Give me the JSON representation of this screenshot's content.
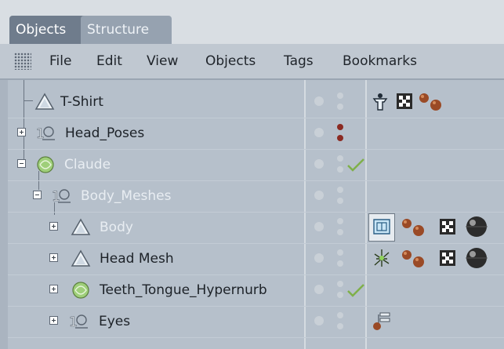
{
  "tabs": [
    {
      "label": "Objects",
      "active": true
    },
    {
      "label": "Structure",
      "active": false
    }
  ],
  "menu": [
    "File",
    "Edit",
    "View",
    "Objects",
    "Tags",
    "Bookmarks"
  ],
  "objects": [
    {
      "name": "T-Shirt",
      "icon": "polygon-object-icon",
      "expander": "none",
      "dim": false,
      "flags": "normal",
      "tags": [
        "character-tag-icon",
        "texture-tag-icon",
        "material-tag-icon"
      ]
    },
    {
      "name": "Head_Poses",
      "icon": "null-object-icon",
      "expander": "plus",
      "dim": false,
      "flags": "red",
      "tags": []
    },
    {
      "name": "Claude",
      "icon": "hypernurbs-object-icon",
      "expander": "minus",
      "dim": true,
      "flags": "check",
      "tags": []
    },
    {
      "name": "Body_Meshes",
      "icon": "null-object-icon",
      "expander": "minus",
      "dim": true,
      "flags": "normal",
      "tags": []
    },
    {
      "name": "Body",
      "icon": "polygon-object-icon",
      "expander": "plus",
      "dim": true,
      "flags": "normal",
      "tags": [
        "restriction-tag-icon",
        "material-tag-icon",
        "texture-tag-icon",
        "sphere-material-icon"
      ]
    },
    {
      "name": "Head Mesh",
      "icon": "polygon-object-icon",
      "expander": "plus",
      "dim": false,
      "flags": "normal",
      "tags": [
        "weight-tag-icon",
        "material-tag-icon",
        "texture-tag-icon",
        "sphere-material-icon"
      ]
    },
    {
      "name": "Teeth_Tongue_Hypernurb",
      "icon": "hypernurbs-object-icon",
      "expander": "plus",
      "dim": false,
      "flags": "check",
      "tags": []
    },
    {
      "name": "Eyes",
      "icon": "null-object-icon",
      "expander": "plus",
      "dim": false,
      "flags": "normal",
      "tags": [
        "target-tag-icon"
      ]
    }
  ],
  "colors": {
    "accent_tab": "#6f7c8c",
    "flag_red": "#8b2a22",
    "check_green": "#7fb04a"
  }
}
